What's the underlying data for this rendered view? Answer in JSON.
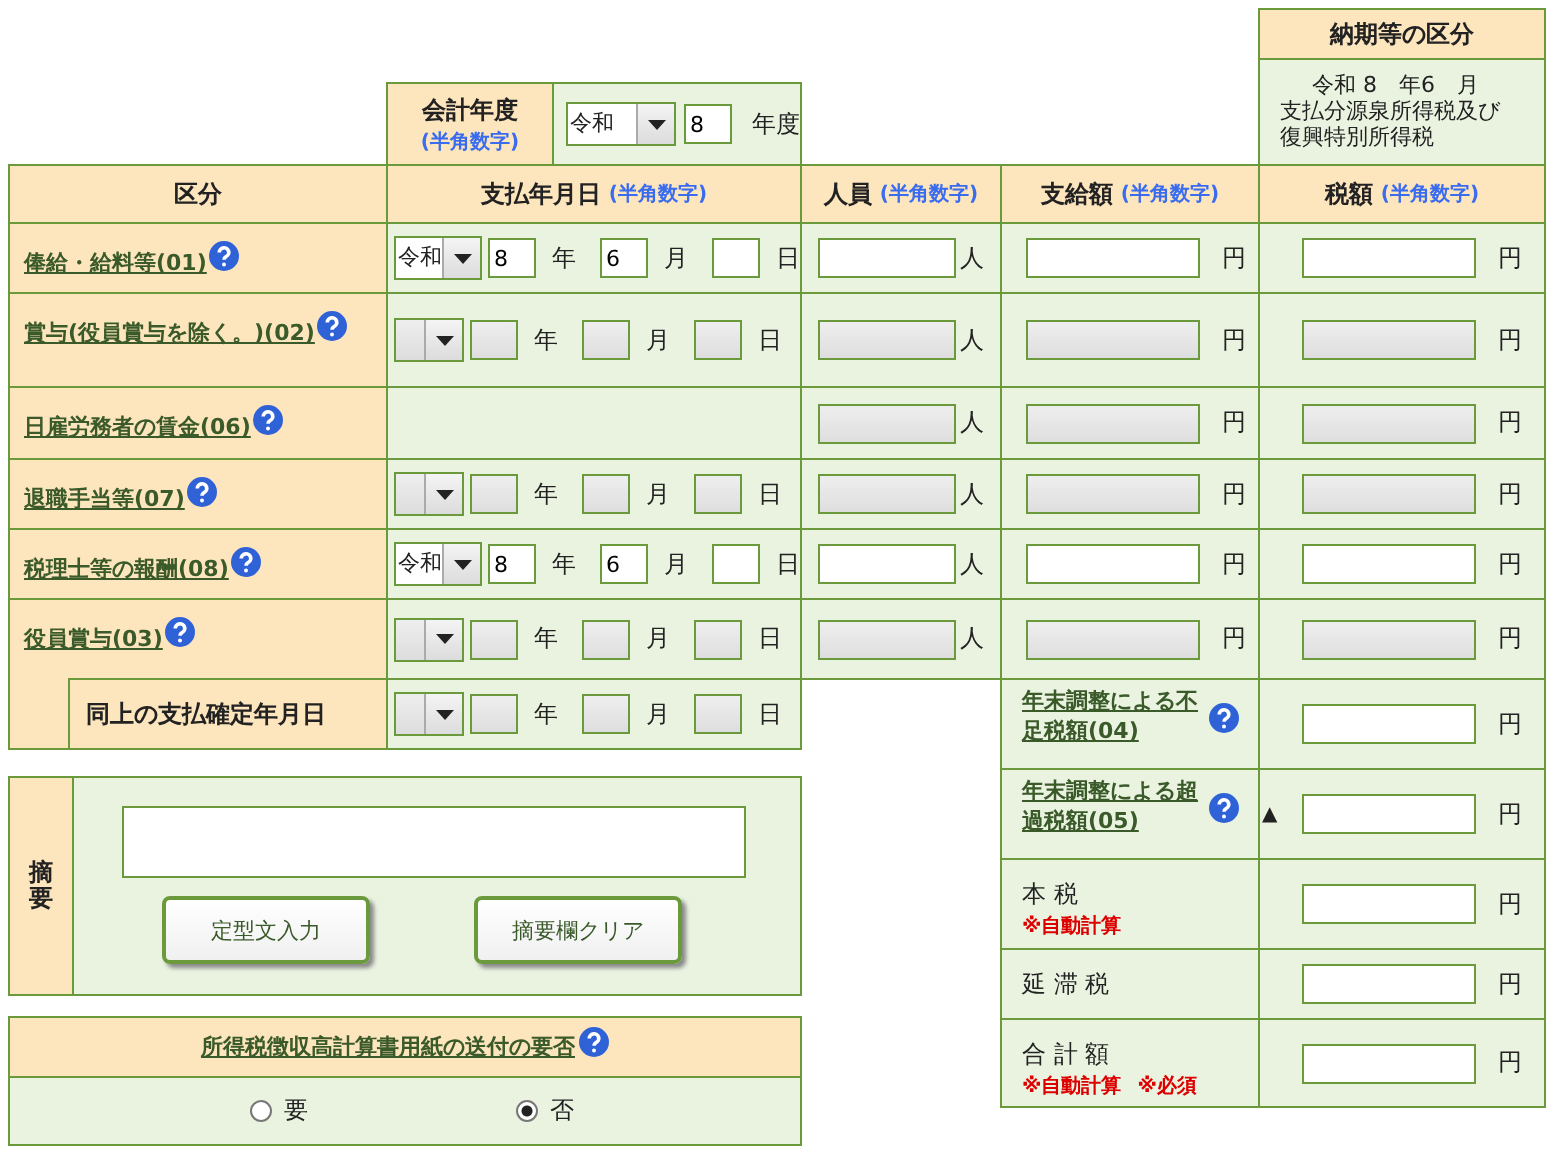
{
  "fiscal_year": {
    "label": "会計年度",
    "note": "(半角数字)",
    "era": "令和",
    "year": "8",
    "unit": "年度"
  },
  "period": {
    "title": "納期等の区分",
    "line": "令和 8　年6　月",
    "text": "支払分源泉所得税及び復興特別所得税"
  },
  "columns": [
    {
      "label": "区分"
    },
    {
      "label": "支払年月日",
      "note": "(半角数字)"
    },
    {
      "label": "人員",
      "note": "(半角数字)"
    },
    {
      "label": "支給額",
      "note": "(半角数字)"
    },
    {
      "label": "税額",
      "note": "(半角数字)"
    }
  ],
  "rows": [
    {
      "label": "俸給・給料等(01)",
      "disabled": false,
      "date": {
        "era": "令和",
        "year": "8",
        "month": "6",
        "units": [
          "年",
          "月",
          "日"
        ]
      },
      "persons_unit": "人",
      "amount_unit": "円",
      "tax_unit": "円"
    },
    {
      "label": "賞与(役員賞与を除く。)(02)",
      "disabled": true,
      "date": {
        "units": [
          "年",
          "月",
          "日"
        ]
      },
      "persons_unit": "人",
      "amount_unit": "円",
      "tax_unit": "円"
    },
    {
      "label": "日雇労務者の賃金(06)",
      "disabled": true,
      "persons_unit": "人",
      "amount_unit": "円",
      "tax_unit": "円"
    },
    {
      "label": "退職手当等(07)",
      "disabled": true,
      "date": {
        "units": [
          "年",
          "月",
          "日"
        ]
      },
      "persons_unit": "人",
      "amount_unit": "円",
      "tax_unit": "円"
    },
    {
      "label": "税理士等の報酬(08)",
      "disabled": false,
      "date": {
        "era": "令和",
        "year": "8",
        "month": "6",
        "units": [
          "年",
          "月",
          "日"
        ]
      },
      "persons_unit": "人",
      "amount_unit": "円",
      "tax_unit": "円"
    },
    {
      "label": "役員賞与(03)",
      "disabled": true,
      "date": {
        "units": [
          "年",
          "月",
          "日"
        ]
      },
      "persons_unit": "人",
      "amount_unit": "円",
      "tax_unit": "円",
      "sub": {
        "label": "同上の支払確定年月日",
        "disabled": true,
        "date": {
          "units": [
            "年",
            "月",
            "日"
          ]
        }
      }
    }
  ],
  "summary": [
    {
      "kind": "link",
      "label": "年末調整による不足税額(04)",
      "unit": "円"
    },
    {
      "kind": "link",
      "label": "年末調整による超過税額(05)",
      "prefix": "▲",
      "unit": "円"
    },
    {
      "kind": "plain",
      "label": "本 税",
      "notes": [
        "※自動計算"
      ],
      "unit": "円"
    },
    {
      "kind": "plain",
      "label": "延 滞 税",
      "unit": "円"
    },
    {
      "kind": "plain",
      "label": "合 計 額",
      "notes": [
        "※自動計算",
        "※必須"
      ],
      "unit": "円"
    }
  ],
  "remarks": {
    "label": "摘要",
    "buttons": [
      "定型文入力",
      "摘要欄クリア"
    ]
  },
  "mailing": {
    "title": "所得税徴収高計算書用紙の送付の要否",
    "options": [
      {
        "label": "要",
        "selected": false
      },
      {
        "label": "否",
        "selected": true
      }
    ]
  }
}
